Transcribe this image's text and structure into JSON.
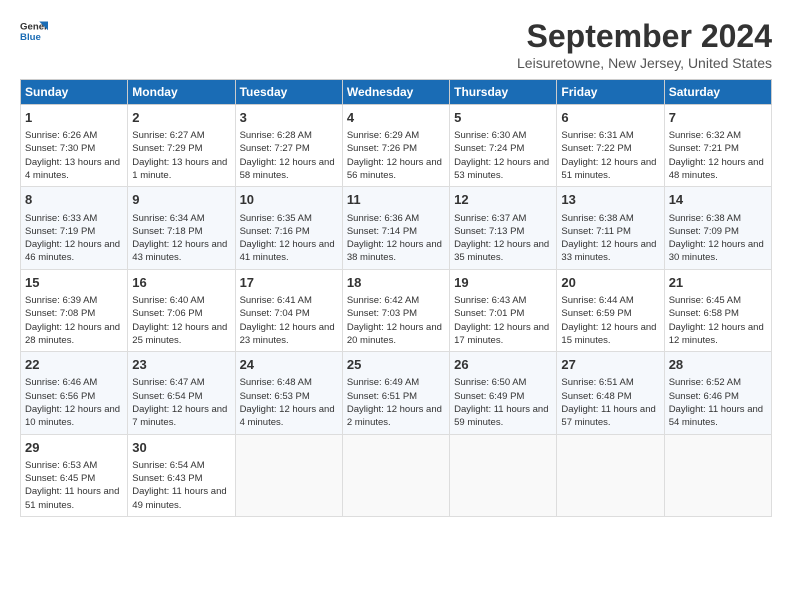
{
  "logo": {
    "line1": "General",
    "line2": "Blue"
  },
  "title": "September 2024",
  "subtitle": "Leisuretowne, New Jersey, United States",
  "headers": [
    "Sunday",
    "Monday",
    "Tuesday",
    "Wednesday",
    "Thursday",
    "Friday",
    "Saturday"
  ],
  "weeks": [
    [
      {
        "day": "1",
        "sunrise": "Sunrise: 6:26 AM",
        "sunset": "Sunset: 7:30 PM",
        "daylight": "Daylight: 13 hours and 4 minutes."
      },
      {
        "day": "2",
        "sunrise": "Sunrise: 6:27 AM",
        "sunset": "Sunset: 7:29 PM",
        "daylight": "Daylight: 13 hours and 1 minute."
      },
      {
        "day": "3",
        "sunrise": "Sunrise: 6:28 AM",
        "sunset": "Sunset: 7:27 PM",
        "daylight": "Daylight: 12 hours and 58 minutes."
      },
      {
        "day": "4",
        "sunrise": "Sunrise: 6:29 AM",
        "sunset": "Sunset: 7:26 PM",
        "daylight": "Daylight: 12 hours and 56 minutes."
      },
      {
        "day": "5",
        "sunrise": "Sunrise: 6:30 AM",
        "sunset": "Sunset: 7:24 PM",
        "daylight": "Daylight: 12 hours and 53 minutes."
      },
      {
        "day": "6",
        "sunrise": "Sunrise: 6:31 AM",
        "sunset": "Sunset: 7:22 PM",
        "daylight": "Daylight: 12 hours and 51 minutes."
      },
      {
        "day": "7",
        "sunrise": "Sunrise: 6:32 AM",
        "sunset": "Sunset: 7:21 PM",
        "daylight": "Daylight: 12 hours and 48 minutes."
      }
    ],
    [
      {
        "day": "8",
        "sunrise": "Sunrise: 6:33 AM",
        "sunset": "Sunset: 7:19 PM",
        "daylight": "Daylight: 12 hours and 46 minutes."
      },
      {
        "day": "9",
        "sunrise": "Sunrise: 6:34 AM",
        "sunset": "Sunset: 7:18 PM",
        "daylight": "Daylight: 12 hours and 43 minutes."
      },
      {
        "day": "10",
        "sunrise": "Sunrise: 6:35 AM",
        "sunset": "Sunset: 7:16 PM",
        "daylight": "Daylight: 12 hours and 41 minutes."
      },
      {
        "day": "11",
        "sunrise": "Sunrise: 6:36 AM",
        "sunset": "Sunset: 7:14 PM",
        "daylight": "Daylight: 12 hours and 38 minutes."
      },
      {
        "day": "12",
        "sunrise": "Sunrise: 6:37 AM",
        "sunset": "Sunset: 7:13 PM",
        "daylight": "Daylight: 12 hours and 35 minutes."
      },
      {
        "day": "13",
        "sunrise": "Sunrise: 6:38 AM",
        "sunset": "Sunset: 7:11 PM",
        "daylight": "Daylight: 12 hours and 33 minutes."
      },
      {
        "day": "14",
        "sunrise": "Sunrise: 6:38 AM",
        "sunset": "Sunset: 7:09 PM",
        "daylight": "Daylight: 12 hours and 30 minutes."
      }
    ],
    [
      {
        "day": "15",
        "sunrise": "Sunrise: 6:39 AM",
        "sunset": "Sunset: 7:08 PM",
        "daylight": "Daylight: 12 hours and 28 minutes."
      },
      {
        "day": "16",
        "sunrise": "Sunrise: 6:40 AM",
        "sunset": "Sunset: 7:06 PM",
        "daylight": "Daylight: 12 hours and 25 minutes."
      },
      {
        "day": "17",
        "sunrise": "Sunrise: 6:41 AM",
        "sunset": "Sunset: 7:04 PM",
        "daylight": "Daylight: 12 hours and 23 minutes."
      },
      {
        "day": "18",
        "sunrise": "Sunrise: 6:42 AM",
        "sunset": "Sunset: 7:03 PM",
        "daylight": "Daylight: 12 hours and 20 minutes."
      },
      {
        "day": "19",
        "sunrise": "Sunrise: 6:43 AM",
        "sunset": "Sunset: 7:01 PM",
        "daylight": "Daylight: 12 hours and 17 minutes."
      },
      {
        "day": "20",
        "sunrise": "Sunrise: 6:44 AM",
        "sunset": "Sunset: 6:59 PM",
        "daylight": "Daylight: 12 hours and 15 minutes."
      },
      {
        "day": "21",
        "sunrise": "Sunrise: 6:45 AM",
        "sunset": "Sunset: 6:58 PM",
        "daylight": "Daylight: 12 hours and 12 minutes."
      }
    ],
    [
      {
        "day": "22",
        "sunrise": "Sunrise: 6:46 AM",
        "sunset": "Sunset: 6:56 PM",
        "daylight": "Daylight: 12 hours and 10 minutes."
      },
      {
        "day": "23",
        "sunrise": "Sunrise: 6:47 AM",
        "sunset": "Sunset: 6:54 PM",
        "daylight": "Daylight: 12 hours and 7 minutes."
      },
      {
        "day": "24",
        "sunrise": "Sunrise: 6:48 AM",
        "sunset": "Sunset: 6:53 PM",
        "daylight": "Daylight: 12 hours and 4 minutes."
      },
      {
        "day": "25",
        "sunrise": "Sunrise: 6:49 AM",
        "sunset": "Sunset: 6:51 PM",
        "daylight": "Daylight: 12 hours and 2 minutes."
      },
      {
        "day": "26",
        "sunrise": "Sunrise: 6:50 AM",
        "sunset": "Sunset: 6:49 PM",
        "daylight": "Daylight: 11 hours and 59 minutes."
      },
      {
        "day": "27",
        "sunrise": "Sunrise: 6:51 AM",
        "sunset": "Sunset: 6:48 PM",
        "daylight": "Daylight: 11 hours and 57 minutes."
      },
      {
        "day": "28",
        "sunrise": "Sunrise: 6:52 AM",
        "sunset": "Sunset: 6:46 PM",
        "daylight": "Daylight: 11 hours and 54 minutes."
      }
    ],
    [
      {
        "day": "29",
        "sunrise": "Sunrise: 6:53 AM",
        "sunset": "Sunset: 6:45 PM",
        "daylight": "Daylight: 11 hours and 51 minutes."
      },
      {
        "day": "30",
        "sunrise": "Sunrise: 6:54 AM",
        "sunset": "Sunset: 6:43 PM",
        "daylight": "Daylight: 11 hours and 49 minutes."
      },
      null,
      null,
      null,
      null,
      null
    ]
  ]
}
